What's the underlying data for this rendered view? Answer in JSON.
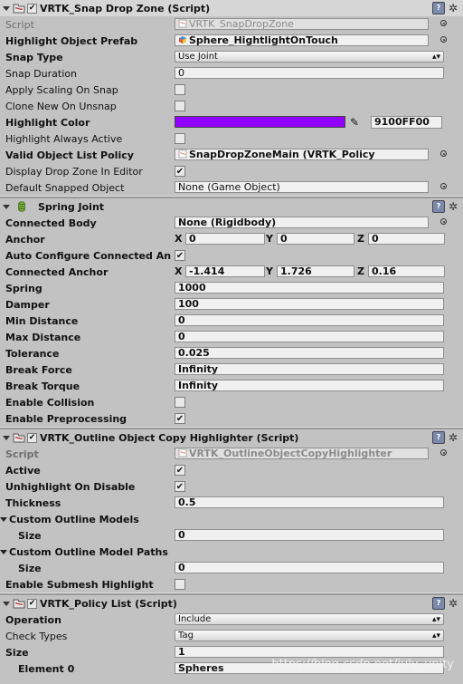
{
  "snap_drop_zone": {
    "title": "VRTK_Snap Drop Zone (Script)",
    "script_label": "Script",
    "script_value": "VRTK_SnapDropZone",
    "highlight_object_prefab_label": "Highlight Object Prefab",
    "highlight_object_prefab_value": "Sphere_HightlightOnTouch",
    "snap_type_label": "Snap Type",
    "snap_type_value": "Use Joint",
    "snap_duration_label": "Snap Duration",
    "snap_duration_value": "0",
    "apply_scaling_label": "Apply Scaling On Snap",
    "apply_scaling_checked": false,
    "clone_new_label": "Clone New On Unsnap",
    "clone_new_checked": false,
    "highlight_color_label": "Highlight Color",
    "highlight_color_hex": "9100FF00",
    "highlight_color_swatch": "#9100ff",
    "highlight_always_active_label": "Highlight Always Active",
    "highlight_always_active_checked": false,
    "valid_object_list_label": "Valid Object List Policy",
    "valid_object_list_value": "SnapDropZoneMain (VRTK_Policy",
    "display_drop_zone_label": "Display Drop Zone In Editor",
    "display_drop_zone_checked": true,
    "default_snapped_label": "Default Snapped Object",
    "default_snapped_value": "None (Game Object)"
  },
  "spring_joint": {
    "title": "Spring Joint",
    "connected_body_label": "Connected Body",
    "connected_body_value": "None (Rigidbody)",
    "anchor_label": "Anchor",
    "anchor": {
      "x": "0",
      "y": "0",
      "z": "0"
    },
    "auto_configure_label": "Auto Configure Connected An",
    "auto_configure_checked": true,
    "connected_anchor_label": "Connected Anchor",
    "connected_anchor": {
      "x": "-1.414",
      "y": "1.726",
      "z": "0.16"
    },
    "spring_label": "Spring",
    "spring_value": "1000",
    "damper_label": "Damper",
    "damper_value": "100",
    "min_distance_label": "Min Distance",
    "min_distance_value": "0",
    "max_distance_label": "Max Distance",
    "max_distance_value": "0",
    "tolerance_label": "Tolerance",
    "tolerance_value": "0.025",
    "break_force_label": "Break Force",
    "break_force_value": "Infinity",
    "break_torque_label": "Break Torque",
    "break_torque_value": "Infinity",
    "enable_collision_label": "Enable Collision",
    "enable_collision_checked": false,
    "enable_preprocessing_label": "Enable Preprocessing",
    "enable_preprocessing_checked": true
  },
  "outline_highlighter": {
    "title": "VRTK_Outline Object Copy Highlighter (Script)",
    "script_label": "Script",
    "script_value": "VRTK_OutlineObjectCopyHighlighter",
    "active_label": "Active",
    "active_checked": true,
    "unhighlight_label": "Unhighlight On Disable",
    "unhighlight_checked": true,
    "thickness_label": "Thickness",
    "thickness_value": "0.5",
    "custom_models_label": "Custom Outline Models",
    "custom_models_size_label": "Size",
    "custom_models_size_value": "0",
    "custom_paths_label": "Custom Outline Model Paths",
    "custom_paths_size_label": "Size",
    "custom_paths_size_value": "0",
    "submesh_label": "Enable Submesh Highlight",
    "submesh_checked": false
  },
  "policy_list": {
    "title": "VRTK_Policy List (Script)",
    "operation_label": "Operation",
    "operation_value": "Include",
    "check_types_label": "Check Types",
    "check_types_value": "Tag",
    "size_label": "Size",
    "size_value": "1",
    "element0_label": "Element 0",
    "element0_value": "Spheres"
  },
  "watermark": "https://blog.csdn.net/july_unity"
}
